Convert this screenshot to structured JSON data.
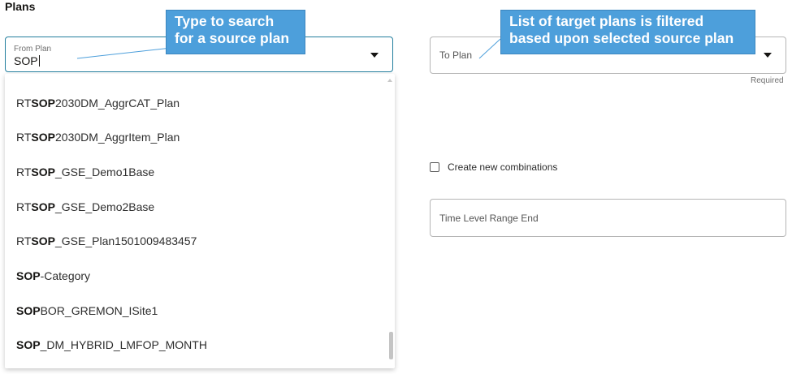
{
  "section": {
    "title": "Plans"
  },
  "from_plan": {
    "label": "From Plan",
    "value": "SOP"
  },
  "dropdown": {
    "options": [
      {
        "prefix": "RT",
        "match": "SOP",
        "suffix": "2030DM_AggrCAT_Plan"
      },
      {
        "prefix": "RT",
        "match": "SOP",
        "suffix": "2030DM_AggrItem_Plan"
      },
      {
        "prefix": "RT",
        "match": "SOP",
        "suffix": "_GSE_Demo1Base"
      },
      {
        "prefix": "RT",
        "match": "SOP",
        "suffix": "_GSE_Demo2Base"
      },
      {
        "prefix": "RT",
        "match": "SOP",
        "suffix": "_GSE_Plan1501009483457"
      },
      {
        "prefix": "",
        "match": "SOP",
        "suffix": "-Category"
      },
      {
        "prefix": "",
        "match": "SOP",
        "suffix": "BOR_GREMON_ISite1"
      },
      {
        "prefix": "",
        "match": "SOP",
        "suffix": "_DM_HYBRID_LMFOP_MONTH"
      }
    ]
  },
  "to_plan": {
    "placeholder": "To Plan",
    "required_text": "Required"
  },
  "create_combinations": {
    "label": "Create new combinations"
  },
  "time_level": {
    "placeholder": "Time Level Range End"
  },
  "callouts": {
    "search": {
      "line1": "Type to search",
      "line2": "for a source plan"
    },
    "target": {
      "line1": "List of target plans is filtered",
      "line2": "based upon selected source plan"
    }
  },
  "colors": {
    "callout_bg": "#4d9fdb",
    "focus_border": "#227e9e"
  }
}
